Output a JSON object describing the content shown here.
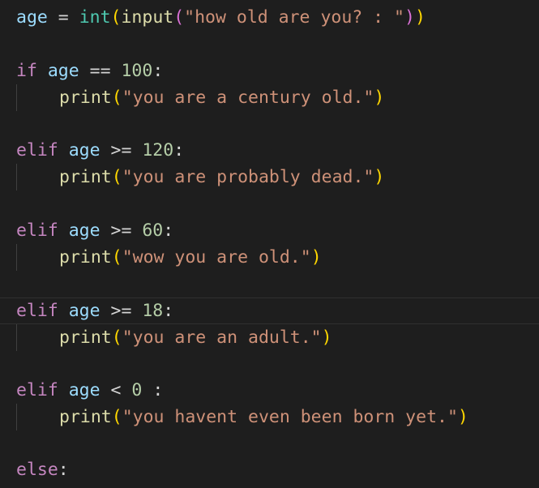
{
  "code": {
    "l1": {
      "var": "age",
      "op": " = ",
      "int": "int",
      "p_open": "(",
      "input": "input",
      "p2_open": "(",
      "str": "\"how old are you? : \"",
      "p2_close": ")",
      "p_close": ")"
    },
    "l2": {
      "kw": "if",
      "var": "age",
      "op": " == ",
      "num": "100",
      "colon": ":"
    },
    "l3": {
      "fn": "print",
      "p_open": "(",
      "str": "\"you are a century old.\"",
      "p_close": ")"
    },
    "l4": {
      "kw": "elif",
      "var": "age",
      "op": " >= ",
      "num": "120",
      "colon": ":"
    },
    "l5": {
      "fn": "print",
      "p_open": "(",
      "str": "\"you are probably dead.\"",
      "p_close": ")"
    },
    "l6": {
      "kw": "elif",
      "var": "age",
      "op": " >= ",
      "num": "60",
      "colon": ":"
    },
    "l7": {
      "fn": "print",
      "p_open": "(",
      "str": "\"wow you are old.\"",
      "p_close": ")"
    },
    "l8": {
      "kw": "elif",
      "var": "age",
      "op": " >= ",
      "num": "18",
      "colon": ":"
    },
    "l9": {
      "fn": "print",
      "p_open": "(",
      "str": "\"you are an adult.\"",
      "p_close": ")"
    },
    "l10": {
      "kw": "elif",
      "var": "age",
      "op": " < ",
      "num": "0",
      "colon": " :"
    },
    "l11": {
      "fn": "print",
      "p_open": "(",
      "str": "\"you havent even been born yet.\"",
      "p_close": ")"
    },
    "l12": {
      "kw": "else",
      "colon": ":"
    }
  },
  "colors": {
    "background": "#1e1e1e",
    "keyword": "#c586c0",
    "variable": "#9cdcfe",
    "function": "#dcdcaa",
    "builtin": "#4ec9b0",
    "string": "#ce9178",
    "number": "#b5cea8",
    "bracket_level1": "#ffd700",
    "bracket_level2": "#da70d6"
  }
}
